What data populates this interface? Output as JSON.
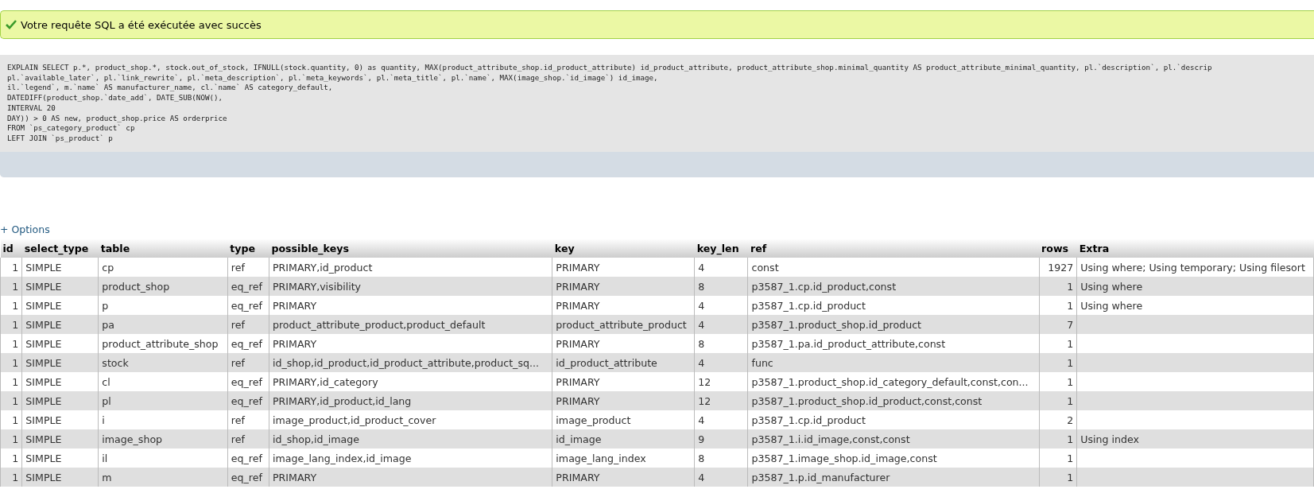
{
  "success_message": {
    "text": "Votre requête SQL a été exécutée avec succès"
  },
  "sql_query": {
    "lines": [
      "EXPLAIN SELECT p.*, product_shop.*, stock.out_of_stock, IFNULL(stock.quantity, 0) as quantity, MAX(product_attribute_shop.id_product_attribute) id_product_attribute, product_attribute_shop.minimal_quantity AS product_attribute_minimal_quantity, pl.`description`, pl.`descrip",
      "pl.`available_later`, pl.`link_rewrite`, pl.`meta_description`, pl.`meta_keywords`, pl.`meta_title`, pl.`name`, MAX(image_shop.`id_image`) id_image,",
      "il.`legend`, m.`name` AS manufacturer_name, cl.`name` AS category_default,",
      "DATEDIFF(product_shop.`date_add`, DATE_SUB(NOW(),",
      "INTERVAL 20",
      "DAY)) > 0 AS new, product_shop.price AS orderprice",
      "FROM `ps_category_product` cp",
      "LEFT JOIN `ps_product` p"
    ]
  },
  "options_link": "+ Options",
  "table": {
    "columns": [
      "id",
      "select_type",
      "table",
      "type",
      "possible_keys",
      "key",
      "key_len",
      "ref",
      "rows",
      "Extra"
    ],
    "rows": [
      [
        "1",
        "SIMPLE",
        "cp",
        "ref",
        "PRIMARY,id_product",
        "PRIMARY",
        "4",
        "const",
        "1927",
        "Using where; Using temporary; Using filesort"
      ],
      [
        "1",
        "SIMPLE",
        "product_shop",
        "eq_ref",
        "PRIMARY,visibility",
        "PRIMARY",
        "8",
        "p3587_1.cp.id_product,const",
        "1",
        "Using where"
      ],
      [
        "1",
        "SIMPLE",
        "p",
        "eq_ref",
        "PRIMARY",
        "PRIMARY",
        "4",
        "p3587_1.cp.id_product",
        "1",
        "Using where"
      ],
      [
        "1",
        "SIMPLE",
        "pa",
        "ref",
        "product_attribute_product,product_default",
        "product_attribute_product",
        "4",
        "p3587_1.product_shop.id_product",
        "7",
        ""
      ],
      [
        "1",
        "SIMPLE",
        "product_attribute_shop",
        "eq_ref",
        "PRIMARY",
        "PRIMARY",
        "8",
        "p3587_1.pa.id_product_attribute,const",
        "1",
        ""
      ],
      [
        "1",
        "SIMPLE",
        "stock",
        "ref",
        "id_shop,id_product,id_product_attribute,product_sq...",
        "id_product_attribute",
        "4",
        "func",
        "1",
        ""
      ],
      [
        "1",
        "SIMPLE",
        "cl",
        "eq_ref",
        "PRIMARY,id_category",
        "PRIMARY",
        "12",
        "p3587_1.product_shop.id_category_default,const,con...",
        "1",
        ""
      ],
      [
        "1",
        "SIMPLE",
        "pl",
        "eq_ref",
        "PRIMARY,id_product,id_lang",
        "PRIMARY",
        "12",
        "p3587_1.product_shop.id_product,const,const",
        "1",
        ""
      ],
      [
        "1",
        "SIMPLE",
        "i",
        "ref",
        "image_product,id_product_cover",
        "image_product",
        "4",
        "p3587_1.cp.id_product",
        "2",
        ""
      ],
      [
        "1",
        "SIMPLE",
        "image_shop",
        "ref",
        "id_shop,id_image",
        "id_image",
        "9",
        "p3587_1.i.id_image,const,const",
        "1",
        "Using index"
      ],
      [
        "1",
        "SIMPLE",
        "il",
        "eq_ref",
        "image_lang_index,id_image",
        "image_lang_index",
        "8",
        "p3587_1.image_shop.id_image,const",
        "1",
        ""
      ],
      [
        "1",
        "SIMPLE",
        "m",
        "eq_ref",
        "PRIMARY",
        "PRIMARY",
        "4",
        "p3587_1.p.id_manufacturer",
        "1",
        ""
      ]
    ]
  }
}
